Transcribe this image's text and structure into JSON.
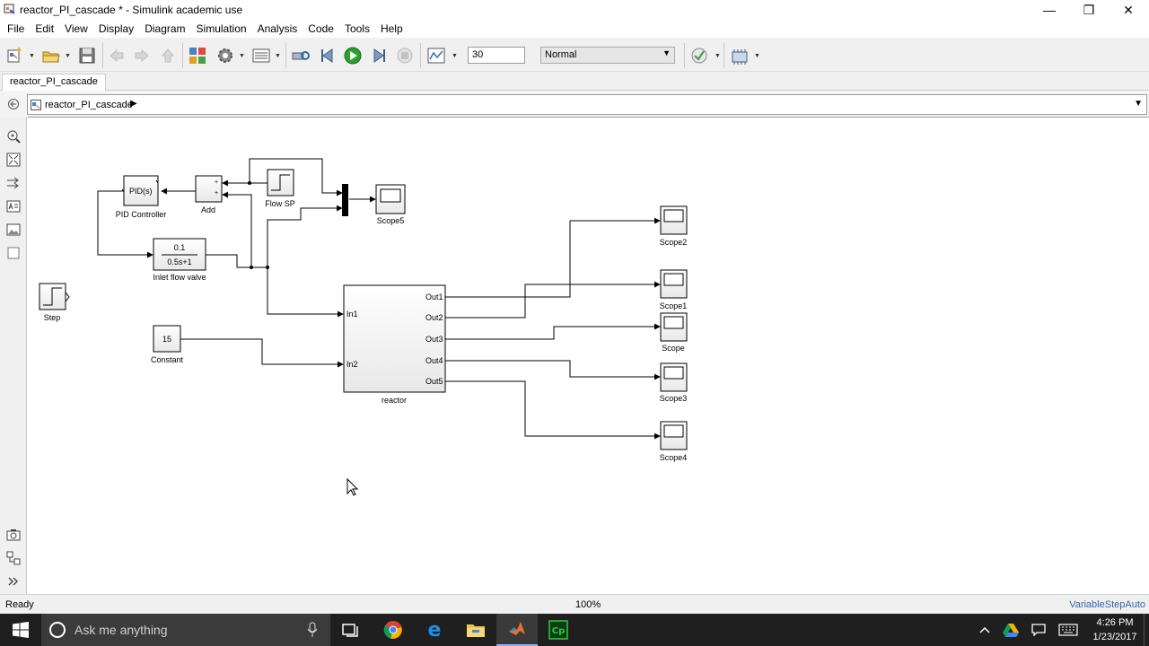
{
  "window": {
    "title": "reactor_PI_cascade * - Simulink academic use",
    "minimize_glyph": "—",
    "restore_glyph": "❐",
    "close_glyph": "✕"
  },
  "menu": [
    "File",
    "Edit",
    "View",
    "Display",
    "Diagram",
    "Simulation",
    "Analysis",
    "Code",
    "Tools",
    "Help"
  ],
  "toolbar": {
    "stop_time": "30",
    "sim_mode": "Normal",
    "run_color": "#2aa12a"
  },
  "tabs": [
    {
      "label": "reactor_PI_cascade"
    }
  ],
  "breadcrumb": {
    "path": "reactor_PI_cascade",
    "arrow": "▶",
    "dropdown": "▼"
  },
  "diagram": {
    "blocks": {
      "pid": {
        "text": "PID(s)",
        "label": "PID Controller"
      },
      "add": {
        "label": "Add",
        "sign1": "+",
        "sign2": "+"
      },
      "flow_sp": {
        "label": "Flow SP"
      },
      "scope5": {
        "label": "Scope5"
      },
      "valve": {
        "numerator": "0.1",
        "denominator": "0.5s+1",
        "label": "Inlet flow valve"
      },
      "step": {
        "label": "Step"
      },
      "constant": {
        "value": "15",
        "label": "Constant"
      },
      "reactor": {
        "label": "reactor",
        "inputs": [
          "In1",
          "In2"
        ],
        "outputs": [
          "Out1",
          "Out2",
          "Out3",
          "Out4",
          "Out5"
        ]
      },
      "scopes": [
        "Scope2",
        "Scope1",
        "Scope",
        "Scope3",
        "Scope4"
      ]
    }
  },
  "status": {
    "left": "Ready",
    "zoom": "100%",
    "solver": "VariableStepAuto"
  },
  "taskbar": {
    "search_placeholder": "Ask me anything",
    "time": "4:26 PM",
    "date": "1/23/2017",
    "matlab_color": "#e0762b",
    "captivate_label": "Cp"
  }
}
